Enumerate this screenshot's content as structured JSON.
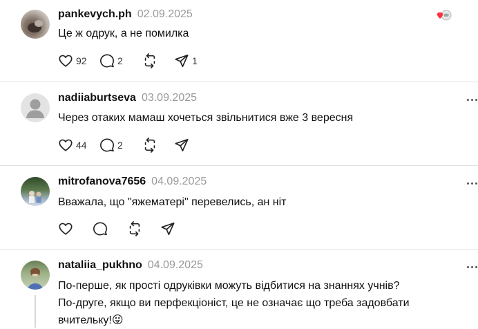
{
  "comments": [
    {
      "username": "pankevych.ph",
      "date": "02.09.2025",
      "text_lines": [
        "Це ж одрук, а не помилка"
      ],
      "likes": "92",
      "replies": "2",
      "reposts": "",
      "shares": "1",
      "avatar_icon": "photo-avatar",
      "has_like_badge": true
    },
    {
      "username": "nadiiaburtseva",
      "date": "03.09.2025",
      "text_lines": [
        "Через отаких мамаш хочеться звільнитися вже 3 вересня"
      ],
      "likes": "44",
      "replies": "2",
      "reposts": "",
      "shares": "",
      "avatar_icon": "default-user-avatar"
    },
    {
      "username": "mitrofanova7656",
      "date": "04.09.2025",
      "text_lines": [
        "Вважала, що \"яжематері\" перевелись, ан ніт"
      ],
      "likes": "",
      "replies": "",
      "reposts": "",
      "shares": "",
      "avatar_icon": "photo-avatar"
    },
    {
      "username": "nataliia_pukhno",
      "date": "04.09.2025",
      "text_lines": [
        "По-перше, як прості одруківки можуть відбитися на знаннях учнів?",
        "По-друге, якщо ви перфекціоніст, це не означає що треба задовбати",
        "вчительку!😜"
      ],
      "avatar_icon": "photo-avatar"
    }
  ],
  "icons": {
    "like": "heart-icon",
    "reply": "comment-bubble-icon",
    "repost": "repost-icon",
    "share": "send-icon",
    "more": "more-dots-icon",
    "badge": "liked-by-author-badge"
  },
  "colors": {
    "accent_like": "#ff3040",
    "text": "#101010",
    "secondary": "#999999"
  }
}
